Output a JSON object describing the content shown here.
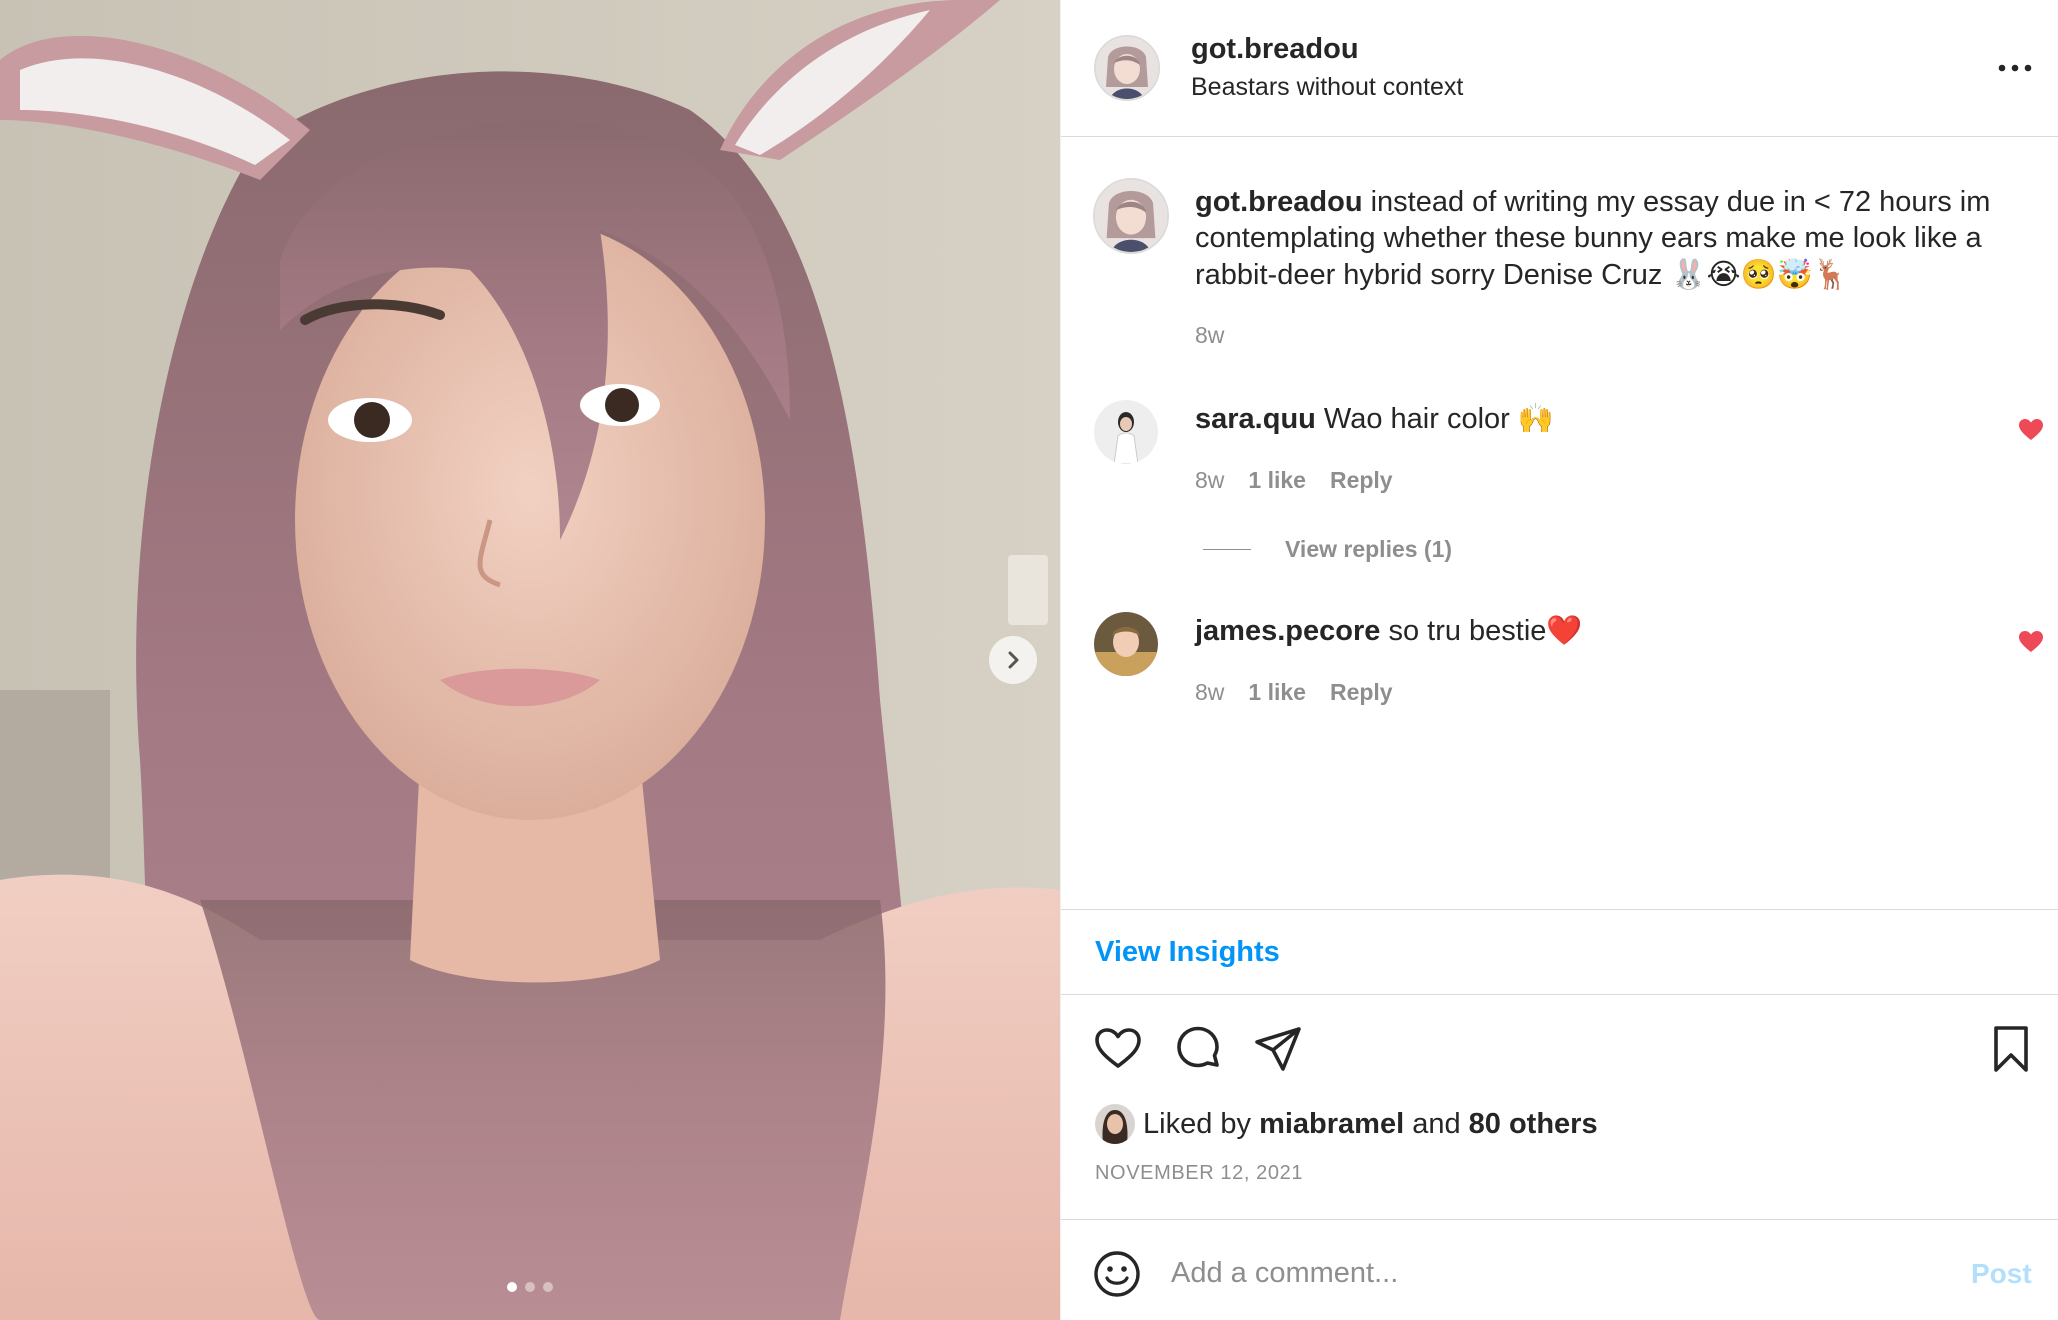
{
  "post": {
    "username": "got.breadou",
    "header_subtitle": "Beastars without context",
    "caption": {
      "username": "got.breadou",
      "text": " instead of writing my essay due in < 72 hours im contemplating whether these bunny ears make me look like a rabbit-deer hybrid sorry Denise Cruz ",
      "emojis": "🐰😭🥺🤯🦌",
      "time": "8w"
    },
    "comments": [
      {
        "username": "sara.quu",
        "text": " Wao hair color ",
        "emoji": "🙌",
        "time": "8w",
        "likes": "1 like",
        "reply_label": "Reply",
        "view_replies": "View replies (1)"
      },
      {
        "username": "james.pecore",
        "text": " so tru bestie",
        "emoji": "❤️",
        "time": "8w",
        "likes": "1 like",
        "reply_label": "Reply"
      }
    ],
    "insights_label": "View Insights",
    "liked_by": {
      "prefix": "Liked by ",
      "user": "miabramel",
      "middle": " and ",
      "others": "80 others"
    },
    "date": "NOVEMBER 12, 2021",
    "add_comment_placeholder": "Add a comment...",
    "post_label": "Post",
    "carousel": {
      "count": 3,
      "active_index": 0
    }
  },
  "colors": {
    "accent": "#0095f6",
    "post_disabled": "#b2dffc",
    "like_red": "#ed4956",
    "text": "#262626",
    "secondary": "#8e8e8e",
    "divider": "#dbdbdb"
  },
  "icons": {
    "more": "more-horizontal-icon",
    "like": "heart-outline-icon",
    "comment": "comment-bubble-icon",
    "share": "paper-plane-icon",
    "save": "bookmark-icon",
    "emoji": "smiley-face-icon",
    "next": "chevron-right-icon",
    "liked": "heart-filled-icon"
  }
}
